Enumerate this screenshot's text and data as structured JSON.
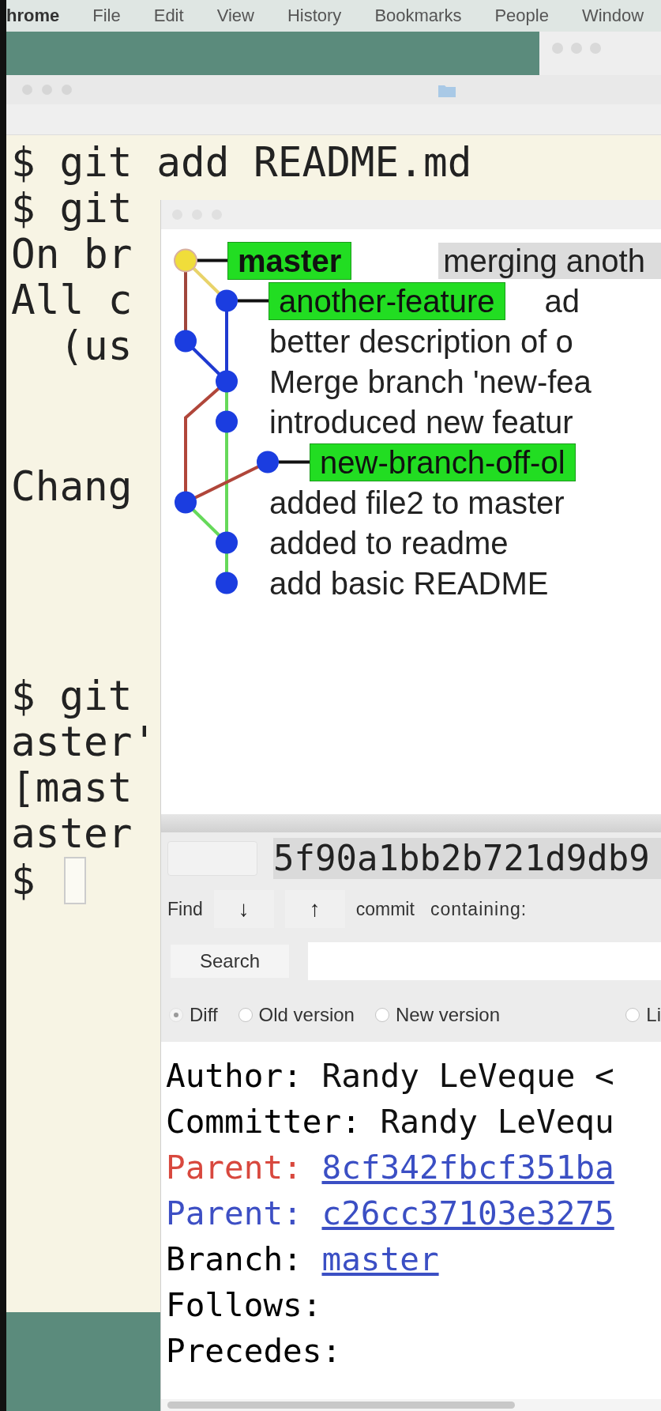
{
  "menu_bar": {
    "items": [
      {
        "label": "hrome",
        "kind": "app"
      },
      {
        "label": "File",
        "kind": "menu"
      },
      {
        "label": "Edit",
        "kind": "menu"
      },
      {
        "label": "View",
        "kind": "menu"
      },
      {
        "label": "History",
        "kind": "menu"
      },
      {
        "label": "Bookmarks",
        "kind": "menu"
      },
      {
        "label": "People",
        "kind": "menu"
      },
      {
        "label": "Window",
        "kind": "menu"
      }
    ]
  },
  "terminal": {
    "blocks": [
      [
        "$ git add README.md",
        "$ git",
        "On br",
        "All c",
        "  (us"
      ],
      [
        "Chang"
      ],
      [
        "$ git",
        "aster'",
        "[mast",
        "aster",
        "$"
      ]
    ]
  },
  "gitk": {
    "graph": {
      "commits": [
        {
          "tag": "master",
          "message": "merging anoth",
          "current": true,
          "selected": true
        },
        {
          "tag": "another-feature",
          "message": "ad",
          "current": false,
          "selected": false
        },
        {
          "message": "better description of o",
          "current": false,
          "selected": false
        },
        {
          "message": "Merge branch 'new-fea",
          "current": false,
          "selected": false
        },
        {
          "message": "introduced new featur",
          "current": false,
          "selected": false
        },
        {
          "tag": "new-branch-off-ol",
          "current": false,
          "selected": false
        },
        {
          "message": "added file2 to master",
          "current": false,
          "selected": false
        },
        {
          "message": "added to readme",
          "current": false,
          "selected": false
        },
        {
          "message": "add basic README",
          "current": false,
          "selected": false
        }
      ]
    },
    "sha": {
      "value": "5f90a1bb2b721d9db9"
    },
    "find": {
      "label": "Find",
      "down": "↓",
      "up": "↑",
      "type": "commit",
      "mode": "containing:"
    },
    "search": {
      "button": "Search"
    },
    "view_options": [
      {
        "label": "Diff",
        "selected": true
      },
      {
        "label": "Old version",
        "selected": false
      },
      {
        "label": "New version",
        "selected": false
      },
      {
        "label": "Li",
        "selected": false
      }
    ],
    "details": [
      {
        "label": "Author:",
        "value": "Randy LeVeque <",
        "kind": "text",
        "color": "#000000"
      },
      {
        "label": "Committer:",
        "value": "Randy LeVequ",
        "kind": "text",
        "color": "#000000"
      },
      {
        "label": "Parent:",
        "value": "8cf342fbcf351ba",
        "kind": "link",
        "color": "#d8483e"
      },
      {
        "label": "Parent:",
        "value": "c26cc37103e3275",
        "kind": "link",
        "color": "#3d4fc4"
      },
      {
        "label": "Branch:",
        "value": "master",
        "kind": "link",
        "color": "#000000"
      },
      {
        "label": "Follows:",
        "kind": "text",
        "color": "#000000"
      },
      {
        "label": "Precedes:",
        "kind": "text",
        "color": "#000000"
      }
    ]
  }
}
